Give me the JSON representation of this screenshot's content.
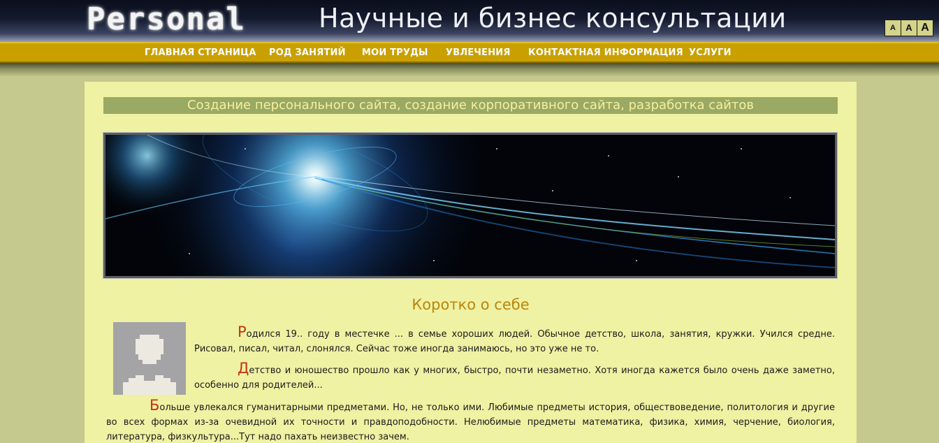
{
  "header": {
    "logo": "Personal",
    "title": "Научные и бизнес консультации",
    "font_switch": [
      "A",
      "A",
      "A"
    ]
  },
  "nav": {
    "items": [
      "ГЛАВНАЯ СТРАНИЦА",
      "РОД ЗАНЯТИЙ",
      "МОИ ТРУДЫ",
      "УВЛЕЧЕНИЯ",
      "КОНТАКТНАЯ ИНФОРМАЦИЯ",
      "УСЛУГИ"
    ]
  },
  "main": {
    "banner_title": "Создание персонального сайта, создание корпоративного сайта, разработка сайтов",
    "about_heading": "Коротко о себе",
    "paragraphs": [
      {
        "initial": "Р",
        "text": "одился 19.. году в местечке ... в семье хороших людей. Обычное детство, школа, занятия, кружки. Учился средне. Рисовал, писал, читал, слонялся. Сейчас тоже иногда занимаюсь, но это уже не то."
      },
      {
        "initial": "Д",
        "text": "етство и юношество прошло как у многих, быстро, почти незаметно. Хотя иногда кажется было очень даже заметно, особенно для родителей..."
      },
      {
        "initial": "Б",
        "text": "ольше увлекался гуманитарными предметами. Но, не только ими. Любимые предметы история, обществоведение, политология и другие во всех формах из-за очевидной их точности и правдоподобности. Нелюбимые предметы математика, физика, химия, черчение, биология, литература, физкультура...Тут надо пахать неизвестно зачем."
      }
    ]
  },
  "colors": {
    "page_bg": "#c5c98e",
    "nav_bg": "#c9a000",
    "content_bg": "#eff1a3",
    "banner_bg": "#9aa963",
    "heading_color": "#b8860b",
    "initial_color": "#c0360f"
  },
  "icons": {
    "avatar": "user-silhouette-icon"
  }
}
